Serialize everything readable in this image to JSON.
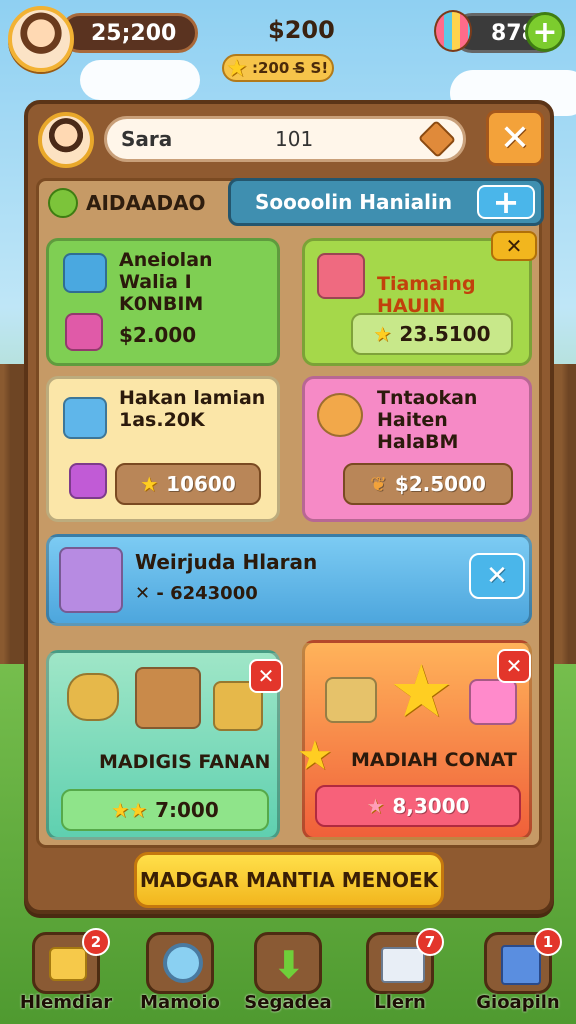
{
  "hud": {
    "coins": "25;200",
    "center_amount": "$200",
    "stars": ":200 S̶ S!",
    "gems": "878",
    "plus": "+"
  },
  "panel": {
    "player_name": "Sara",
    "player_level": "101",
    "close": "✕",
    "category": "AIDAADAO",
    "shop_title": "Soooolin Hanialin",
    "shop_plus": "+"
  },
  "cards": [
    {
      "title": "Aneiolan Walia I K0NBIM",
      "price": "$2.000",
      "color": "#7fcf53"
    },
    {
      "title": "Tiamaing HAUIN",
      "price": "23.5100",
      "color": "#a5d84a"
    },
    {
      "title": "Hakan lamian 1as.20K",
      "price": "10600",
      "color": "#fbe6a8"
    },
    {
      "title": "Tntaokan Haiten HalaBM",
      "price": "$2.5000",
      "color": "#f68ac6"
    }
  ],
  "wide_card": {
    "title": "Weirjuda Hlaran",
    "subtitle": "✕ - 6243000",
    "close": "✕"
  },
  "bundles": [
    {
      "title": "MADIGIS FANAN",
      "price": "7:000"
    },
    {
      "title": "MADIAH CONAT",
      "price": "8,3000"
    }
  ],
  "cta": "MADGAR MANTIA MENOEK",
  "nav": [
    {
      "label": "Hlemdiar",
      "badge": "2"
    },
    {
      "label": "Mamoio",
      "badge": ""
    },
    {
      "label": "Segadea",
      "badge": ""
    },
    {
      "label": "Llern",
      "badge": "7"
    },
    {
      "label": "Gioapiln",
      "badge": "1"
    }
  ],
  "colors": {
    "panel_wood": "#8f5a30",
    "accent_gold": "#f2b61e",
    "accent_blue": "#3f8fb0"
  }
}
